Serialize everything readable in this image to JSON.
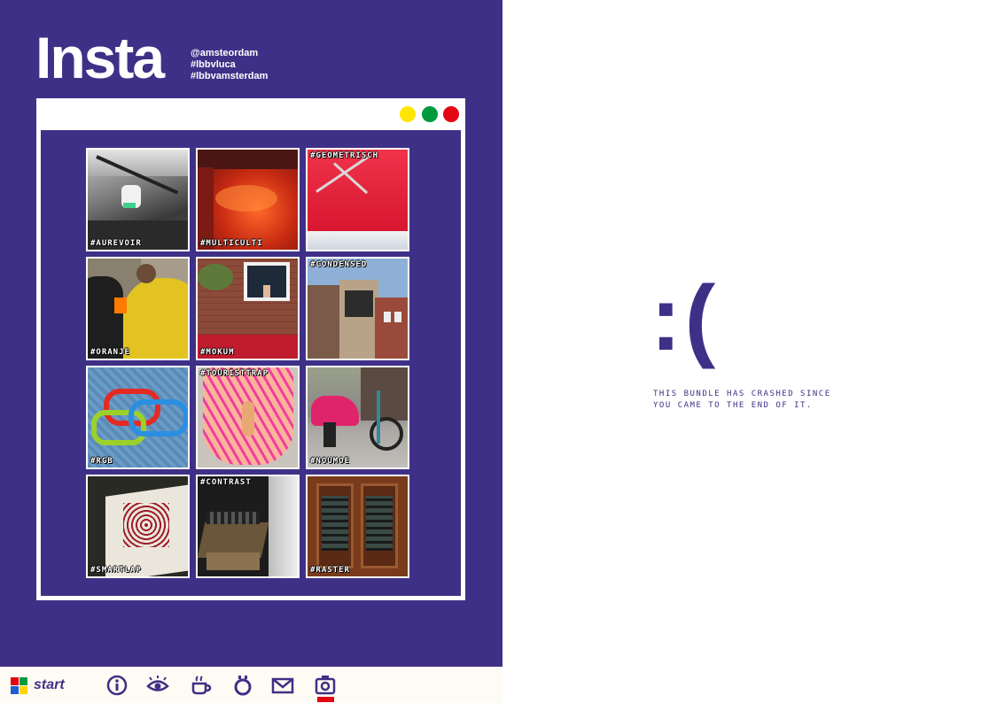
{
  "header": {
    "brand": "Insta",
    "tags": [
      "@amsteordam",
      "#lbbvluca",
      "#lbbvamsterdam"
    ]
  },
  "window": {
    "controls": [
      {
        "name": "minimize",
        "color": "#ffe600"
      },
      {
        "name": "maximize",
        "color": "#009a3d"
      },
      {
        "name": "close",
        "color": "#e30613"
      }
    ]
  },
  "grid": {
    "tiles": [
      {
        "tag": "#AUREVOIR",
        "position": "bottom"
      },
      {
        "tag": "#MULTICULTI",
        "position": "bottom"
      },
      {
        "tag": "#GEOMETRISCH",
        "position": "top"
      },
      {
        "tag": "#ORANJE",
        "position": "bottom"
      },
      {
        "tag": "#MOKUM",
        "position": "bottom"
      },
      {
        "tag": "#CONDENSED",
        "position": "top"
      },
      {
        "tag": "#RGB",
        "position": "bottom"
      },
      {
        "tag": "#TOURISTTRAP",
        "position": "top"
      },
      {
        "tag": "#NOUMOE",
        "position": "bottom"
      },
      {
        "tag": "#SMARTLAP",
        "position": "bottom"
      },
      {
        "tag": "#CONTRAST",
        "position": "top"
      },
      {
        "tag": "#RASTER",
        "position": "bottom"
      }
    ]
  },
  "crash": {
    "face": ":(",
    "message_line1": "THIS BUNDLE HAS CRASHED SINCE",
    "message_line2": "YOU CAME TO THE END OF IT."
  },
  "taskbar": {
    "start_label": "start",
    "icons": [
      "info-icon",
      "eye-icon",
      "coffee-icon",
      "ring-icon",
      "mail-icon",
      "camera-icon"
    ],
    "active": "camera-icon"
  },
  "colors": {
    "panel": "#3f3087",
    "accent": "#e30613",
    "taskbar": "#fdfbf3"
  }
}
